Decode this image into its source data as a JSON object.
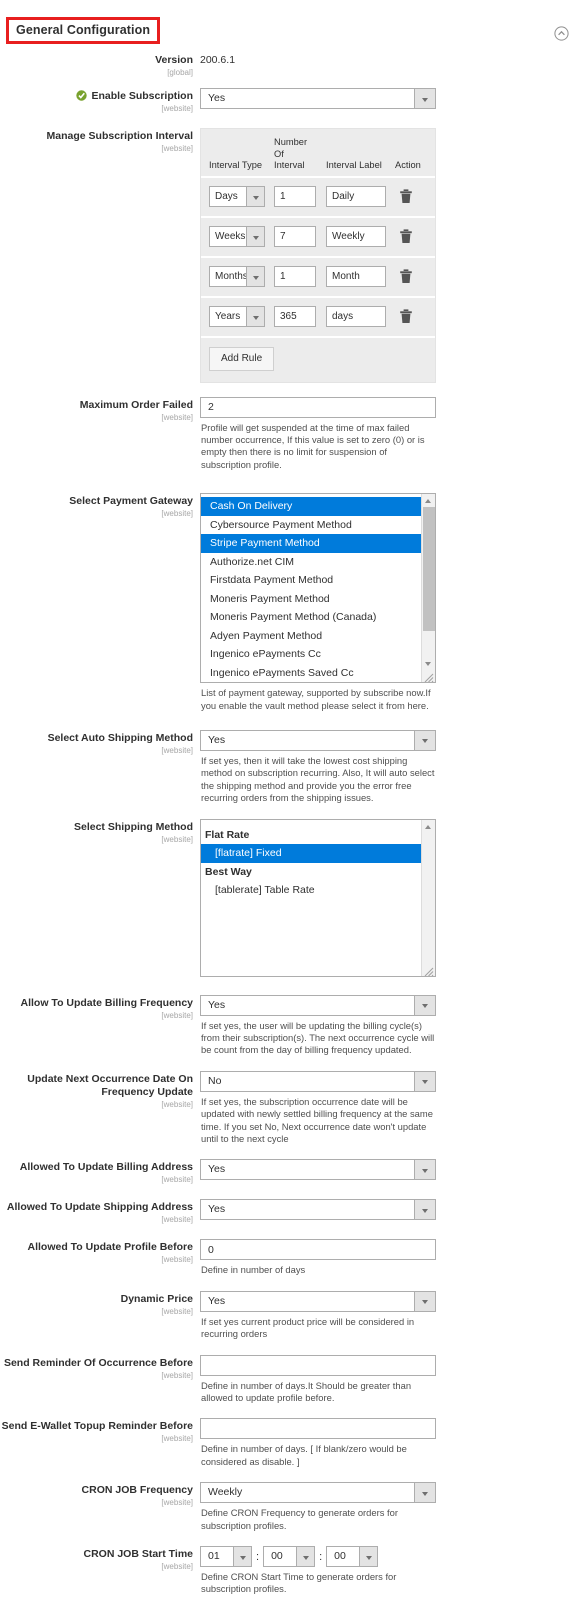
{
  "header": {
    "title": "General Configuration",
    "collapse_icon": "chevron-up-circle-icon"
  },
  "scope_global": "[global]",
  "scope_website": "[website]",
  "fields": {
    "version": {
      "label": "Version",
      "scope": "[global]",
      "value": "200.6.1"
    },
    "enable_subscription": {
      "label": "Enable Subscription",
      "scope": "[website]",
      "value": "Yes",
      "icon": "green-check-circle-icon"
    },
    "manage_interval": {
      "label": "Manage Subscription Interval",
      "scope": "[website]",
      "columns": [
        "Interval Type",
        "Number Of Interval",
        "Interval Label",
        "Action"
      ],
      "col_number_lines": [
        "Number",
        "Of",
        "Interval"
      ],
      "rows": [
        {
          "interval_type": "Days",
          "number": "1",
          "interval_label": "Daily",
          "action": "delete-icon"
        },
        {
          "interval_type": "Weeks",
          "number": "7",
          "interval_label": "Weekly",
          "action": "delete-icon"
        },
        {
          "interval_type": "Months",
          "number": "1",
          "interval_label": "Month",
          "action": "delete-icon"
        },
        {
          "interval_type": "Years",
          "number": "365",
          "interval_label": "days",
          "action": "delete-icon"
        }
      ],
      "add_button": "Add Rule"
    },
    "maximum_order_failed": {
      "label": "Maximum Order Failed",
      "scope": "[website]",
      "value": "2",
      "note": "Profile will get suspended at the time of max failed number occurrence, If this value is set to zero (0) or is empty then there is no limit for suspension of subscription profile."
    },
    "select_payment_gateway": {
      "label": "Select Payment Gateway",
      "scope": "[website]",
      "options": [
        {
          "label": "Cash On Delivery",
          "selected": true
        },
        {
          "label": "Cybersource Payment Method",
          "selected": false
        },
        {
          "label": "Stripe Payment Method",
          "selected": true
        },
        {
          "label": "Authorize.net CIM",
          "selected": false
        },
        {
          "label": "Firstdata Payment Method",
          "selected": false
        },
        {
          "label": "Moneris Payment Method",
          "selected": false
        },
        {
          "label": "Moneris Payment Method (Canada)",
          "selected": false
        },
        {
          "label": "Adyen Payment Method",
          "selected": false
        },
        {
          "label": "Ingenico ePayments Cc",
          "selected": false
        },
        {
          "label": "Ingenico ePayments Saved Cc",
          "selected": false
        }
      ],
      "note": "List of payment gateway, supported by subscribe now.If you enable the vault method please select it from here."
    },
    "select_auto_shipping_method": {
      "label": "Select Auto Shipping Method",
      "scope": "[website]",
      "value": "Yes",
      "note": "If set yes, then it will take the lowest cost shipping method on subscription recurring. Also, It will auto select the shipping method and provide you the error free recurring orders from the shipping issues."
    },
    "select_shipping_method": {
      "label": "Select Shipping Method",
      "scope": "[website]",
      "groups": [
        {
          "group": "Flat Rate",
          "options": [
            {
              "label": "[flatrate] Fixed",
              "selected": true
            }
          ]
        },
        {
          "group": "Best Way",
          "options": [
            {
              "label": "[tablerate] Table Rate",
              "selected": false
            }
          ]
        }
      ]
    },
    "allow_update_billing_frequency": {
      "label": "Allow To Update Billing Frequency",
      "scope": "[website]",
      "value": "Yes",
      "note": "If set yes, the user will be updating the billing cycle(s) from their subscription(s). The next occurrence cycle will be count from the day of billing frequency updated."
    },
    "update_next_occurrence_date": {
      "label": "Update Next Occurrence Date On Frequency Update",
      "scope": "[website]",
      "value": "No",
      "note": "If set yes, the subscription occurrence date will be updated with newly settled billing frequency at the same time. If you set No, Next occurrence date won't update until to the next cycle"
    },
    "allowed_update_billing_address": {
      "label": "Allowed To Update Billing Address",
      "scope": "[website]",
      "value": "Yes"
    },
    "allowed_update_shipping_address": {
      "label": "Allowed To Update Shipping Address",
      "scope": "[website]",
      "value": "Yes"
    },
    "allowed_update_profile_before": {
      "label": "Allowed To Update Profile Before",
      "scope": "[website]",
      "value": "0",
      "note": "Define in number of days"
    },
    "dynamic_price": {
      "label": "Dynamic Price",
      "scope": "[website]",
      "value": "Yes",
      "note": "If set yes current product price will be considered in recurring orders"
    },
    "send_reminder_occurrence_before": {
      "label": "Send Reminder Of Occurrence Before",
      "scope": "[website]",
      "value": "",
      "note": "Define in number of days.It Should be greater than allowed to update profile before."
    },
    "send_ewallet_topup_reminder_before": {
      "label": "Send E-Wallet Topup Reminder Before",
      "scope": "[website]",
      "value": "",
      "note": "Define in number of days. [ If blank/zero would be considered as disable. ]"
    },
    "cron_job_frequency": {
      "label": "CRON JOB Frequency",
      "scope": "[website]",
      "value": "Weekly",
      "note": "Define CRON Frequency to generate orders for subscription profiles."
    },
    "cron_job_start_time": {
      "label": "CRON JOB Start Time",
      "scope": "[website]",
      "hours": "01",
      "minutes": "00",
      "seconds": "00",
      "separator": ":",
      "note": "Define CRON Start Time to generate orders for subscription profiles."
    }
  },
  "colors": {
    "selected_blue": "#007bdb",
    "annotation_red": "#e81f1f",
    "enabled_green": "#79a22e",
    "table_bg": "#ececec"
  }
}
